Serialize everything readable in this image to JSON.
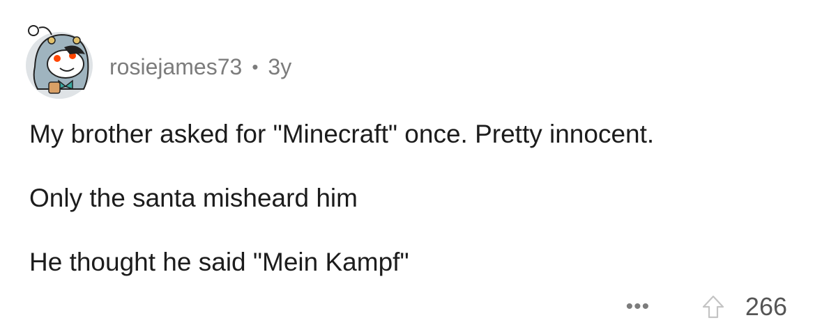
{
  "comment": {
    "username": "rosiejames73",
    "separator": "•",
    "age": "3y",
    "body_lines": [
      "My brother asked for \"Minecraft\" once. Pretty innocent.",
      "Only the santa misheard him",
      "He thought he said \"Mein Kampf\""
    ],
    "more_label": "•••",
    "score": "266",
    "icons": {
      "avatar": "snoo-avatar-icon",
      "more": "more-options-icon",
      "upvote": "upvote-arrow-icon"
    },
    "colors": {
      "meta_text": "#7c7c7c",
      "body_text": "#1c1c1c",
      "score_text": "#555555",
      "avatar_bg": "#dfe3e6",
      "snoo_red": "#ff4500"
    }
  }
}
